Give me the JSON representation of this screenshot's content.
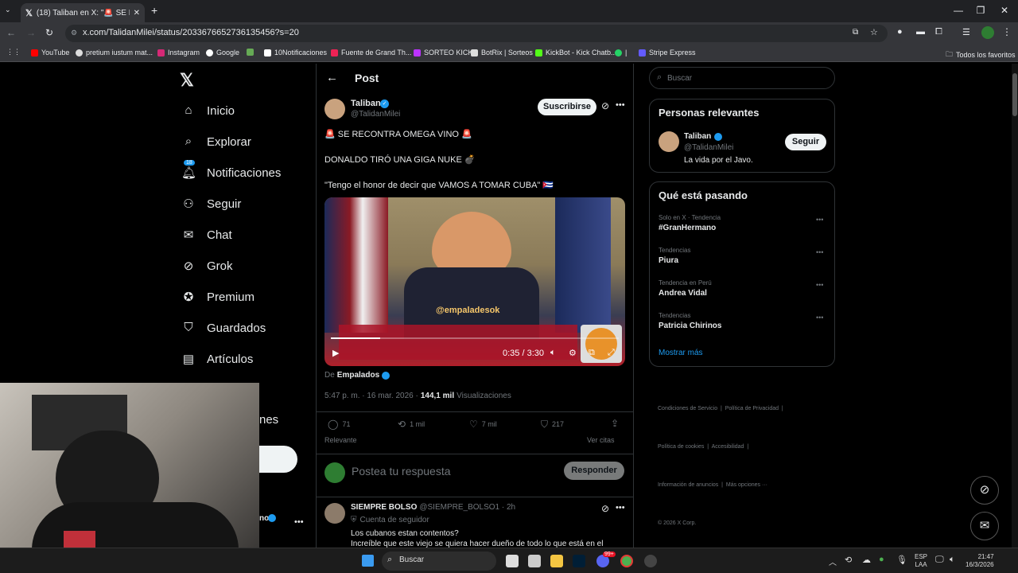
{
  "browser": {
    "tab_count_title": "(18) Taliban en X: \"🚨 SE RECON",
    "url": "x.com/TalidanMilei/status/2033676652736135456?s=20",
    "bookmarks": [
      "YouTube",
      "pretium iustum mat...",
      "Instagram",
      "Google",
      "10Notificaciones",
      "Fuente de Grand Th...",
      "SORTEO KICK",
      "BotRix | Sorteos",
      "KickBot - Kick Chatb...",
      "|",
      "Stripe Express"
    ],
    "all_bookmarks": "Todos los favoritos"
  },
  "sidebar": {
    "items": [
      {
        "label": "Inicio",
        "icon": "home-icon"
      },
      {
        "label": "Explorar",
        "icon": "search-icon"
      },
      {
        "label": "Notificaciones",
        "icon": "bell-icon",
        "badge": "18"
      },
      {
        "label": "Seguir",
        "icon": "follow-icon"
      },
      {
        "label": "Chat",
        "icon": "mail-icon"
      },
      {
        "label": "Grok",
        "icon": "grok-icon"
      },
      {
        "label": "Premium",
        "icon": "premium-icon"
      },
      {
        "label": "Guardados",
        "icon": "bookmark-icon"
      },
      {
        "label": "Artículos",
        "icon": "articles-icon"
      }
    ],
    "partial_label": "nes",
    "partial_account": "no"
  },
  "post": {
    "header": "Post",
    "author_name": "Taliban",
    "author_handle": "@TalidanMilei",
    "subscribe_label": "Suscribirse",
    "line1": "🚨 SE RECONTRA OMEGA VINO 🚨",
    "line2": "DONALDO TIRÓ UNA GIGA NUKE 💣",
    "line3": "\"Tengo el honor de decir que VAMOS A TOMAR CUBA\" 🇨🇺",
    "video_watermark": "@empaladesok",
    "video_time": "0:35 / 3:30",
    "video_progress": 0.17,
    "from_prefix": "De",
    "from_account": "Empalados",
    "time": "5:47 p. m. · 16 mar. 2026 ·",
    "views_count": "144,1 mil",
    "views_label": "Visualizaciones",
    "replies": "71",
    "reposts": "1 mil",
    "likes": "7 mil",
    "bookmarks": "217",
    "sort_label": "Relevante",
    "quotes_label": "Ver citas",
    "reply_placeholder": "Postea tu respuesta",
    "reply_button": "Responder"
  },
  "reply": {
    "name": "SIEMPRE BOLSO",
    "handle": "@SIEMPRE_BOLSO1 · 2h",
    "badge": "Cuenta de seguidor",
    "line1": "Los cubanos estan contentos?",
    "line2": "Increíble que este viejo se quiera hacer dueño de todo lo que está en el"
  },
  "right": {
    "search_placeholder": "Buscar",
    "relevant_title": "Personas relevantes",
    "relevant_name": "Taliban",
    "relevant_handle": "@TalidanMilei",
    "relevant_bio": "La vida por el Javo.",
    "follow_label": "Seguir",
    "trends_title": "Qué está pasando",
    "trends": [
      {
        "context": "Solo en X · Tendencia",
        "name": "#GranHermano"
      },
      {
        "context": "Tendencias",
        "name": "Piura"
      },
      {
        "context": "Tendencia en Perú",
        "name": "Andrea Vidal"
      },
      {
        "context": "Tendencias",
        "name": "Patricia Chirinos"
      }
    ],
    "show_more": "Mostrar más",
    "footer1": "Condiciones de Servicio  |  Política de Privacidad  |",
    "footer2": "Política de cookies  |  Accesibilidad  |",
    "footer3": "Información de anuncios  |  Más opciones ···",
    "footer4": "© 2026 X Corp."
  },
  "taskbar": {
    "search": "Buscar",
    "lang1": "ESP",
    "lang2": "LAA",
    "time": "21:47",
    "date": "16/3/2026",
    "notif_badge": "99+"
  },
  "colors": {
    "accent": "#1d9bf0",
    "bg": "#000000",
    "border": "#2f3336"
  }
}
